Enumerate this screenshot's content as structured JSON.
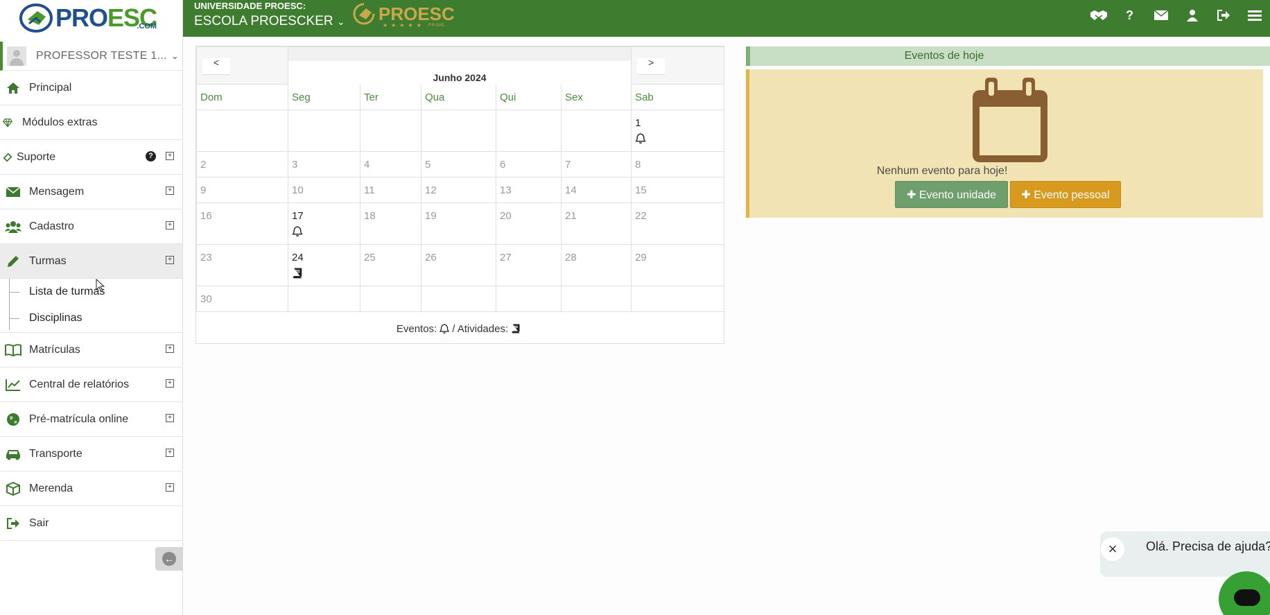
{
  "brand": {
    "logo_main": "PRO",
    "logo_accent": "ESC",
    "logo_suffix": ".COM",
    "prime_name": "PROESC",
    "prime_stars": "★★★★★",
    "prime_word": "PRIME"
  },
  "header": {
    "university": "UNIVERSIDADE PROESC:",
    "school": "ESCOLA PROESCKER",
    "school_caret": "⌄"
  },
  "top_icons": [
    "handshake-icon",
    "help-icon",
    "envelope-icon",
    "user-icon",
    "logout-icon",
    "menu-icon"
  ],
  "user": {
    "name": "PROFESSOR TESTE 1...",
    "caret": "⌄"
  },
  "sidebar": {
    "items": [
      {
        "label": "Principal",
        "icon": "home-icon"
      },
      {
        "label": "Módulos extras",
        "icon": "diamond-icon"
      },
      {
        "label": "Suporte",
        "icon": "ticket-icon",
        "expand": "⊞",
        "help": "?"
      },
      {
        "label": "Mensagem",
        "icon": "envelope-icon",
        "expand": "⊞"
      },
      {
        "label": "Cadastro",
        "icon": "users-icon",
        "expand": "⊞"
      },
      {
        "label": "Turmas",
        "icon": "pencil-icon",
        "expand": "⊞"
      },
      {
        "label": "Matrículas",
        "icon": "book-icon",
        "expand": "⊞"
      },
      {
        "label": "Central de relatórios",
        "icon": "chart-icon",
        "expand": "⊞"
      },
      {
        "label": "Pré-matrícula online",
        "icon": "globe-icon",
        "expand": "⊞"
      },
      {
        "label": "Transporte",
        "icon": "car-icon",
        "expand": "⊞"
      },
      {
        "label": "Merenda",
        "icon": "box-icon",
        "expand": "⊞"
      },
      {
        "label": "Sair",
        "icon": "logout-icon"
      }
    ],
    "turmas_sub": [
      "Lista de turmas",
      "Disciplinas"
    ],
    "collapse_icon": "⮜"
  },
  "calendar": {
    "prev": "<",
    "next": ">",
    "month": "Junho 2024",
    "weekdays": [
      "Dom",
      "Seg",
      "Ter",
      "Qua",
      "Qui",
      "Sex",
      "Sab"
    ],
    "weeks": [
      [
        "",
        "",
        "",
        "",
        "",
        "",
        "1"
      ],
      [
        "2",
        "3",
        "4",
        "5",
        "6",
        "7",
        "8"
      ],
      [
        "9",
        "10",
        "11",
        "12",
        "13",
        "14",
        "15"
      ],
      [
        "16",
        "17",
        "18",
        "19",
        "20",
        "21",
        "22"
      ],
      [
        "23",
        "24",
        "25",
        "26",
        "27",
        "28",
        "29"
      ],
      [
        "30",
        "",
        "",
        "",
        "",
        "",
        ""
      ]
    ],
    "markers": {
      "1": "bell",
      "17": "bell",
      "24": "book"
    },
    "legend_events": "Eventos:",
    "legend_sep": "/ Atividades:"
  },
  "events": {
    "title": "Eventos de hoje",
    "empty": "Nenhum evento para hoje!",
    "btn_unit": "✚ Evento unidade",
    "btn_personal": "✚ Evento pessoal"
  },
  "chat": {
    "message": "Olá. Precisa de ajuda?",
    "close": "×"
  },
  "colors": {
    "primary": "#3e7d2f",
    "accent": "#d79a1f",
    "events_bg": "#f1e3b3",
    "header_green": "#c8dfc6"
  }
}
